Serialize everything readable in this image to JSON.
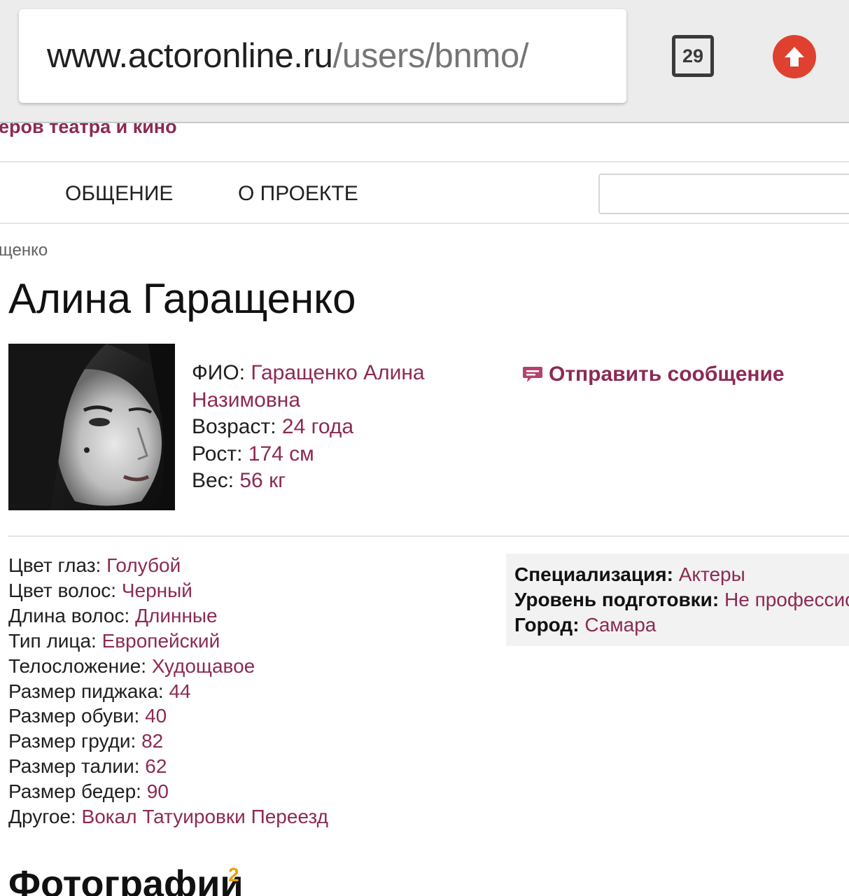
{
  "browser": {
    "url_host": "www.actoronline.ru",
    "url_path": "/users/bnmo/",
    "tab_count": "29",
    "update_icon": "arrow-up-circle-icon",
    "accent_update": "#e0402f"
  },
  "site": {
    "banner_text": "еров театра и кино",
    "nav": [
      "ОБЩЕНИЕ",
      "О ПРОЕКТЕ"
    ],
    "search_placeholder": "",
    "brand_color": "#8c2a54"
  },
  "breadcrumb": "щенко",
  "profile": {
    "title": "Алина Гаращенко",
    "info": [
      {
        "label": "ФИО:",
        "value": "Гаращенко Алина Назимовна"
      },
      {
        "label": "Возраст:",
        "value": "24 года"
      },
      {
        "label": "Рост:",
        "value": "174 см"
      },
      {
        "label": "Вес:",
        "value": "56 кг"
      }
    ],
    "send_message": "Отправить сообщение",
    "send_message_icon": "speech-bubble-icon"
  },
  "attributes": [
    {
      "label": "Цвет глаз:",
      "value": "Голубой"
    },
    {
      "label": "Цвет волос:",
      "value": "Черный"
    },
    {
      "label": "Длина волос:",
      "value": "Длинные"
    },
    {
      "label": "Тип лица:",
      "value": "Европейский"
    },
    {
      "label": "Телосложение:",
      "value": "Худощавое"
    },
    {
      "label": "Размер пиджака:",
      "value": "44"
    },
    {
      "label": "Размер обуви:",
      "value": "40"
    },
    {
      "label": "Размер груди:",
      "value": "82"
    },
    {
      "label": "Размер талии:",
      "value": "62"
    },
    {
      "label": "Размер бедер:",
      "value": "90"
    },
    {
      "label": "Другое:",
      "value": "Вокал Татуировки Переезд"
    }
  ],
  "specialization": [
    {
      "label": "Специализация:",
      "value": "Актеры"
    },
    {
      "label": "Уровень подготовки:",
      "value": "Не профессионал"
    },
    {
      "label": "Город:",
      "value": "Самара"
    }
  ],
  "photos": {
    "title": "Фотографии",
    "count": "2"
  }
}
